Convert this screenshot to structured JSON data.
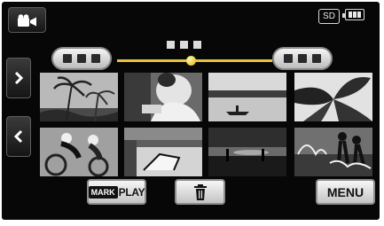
{
  "status": {
    "media": "SD",
    "mode_icon": "video-camera-icon",
    "battery_icon": "battery-icon"
  },
  "buttons": {
    "mark": "MARK",
    "play": "PLAY",
    "menu": "MENU",
    "delete_icon": "trash-icon",
    "next_icon": "chevron-right-icon",
    "prev_icon": "chevron-left-icon"
  },
  "thumbnails": [
    {
      "subject": "palm-trees"
    },
    {
      "subject": "person-reading"
    },
    {
      "subject": "lake-canoe"
    },
    {
      "subject": "palm-leaves"
    },
    {
      "subject": "cyclists"
    },
    {
      "subject": "beach-chair"
    },
    {
      "subject": "beach-silhouettes"
    },
    {
      "subject": "kids-water-splash"
    }
  ]
}
